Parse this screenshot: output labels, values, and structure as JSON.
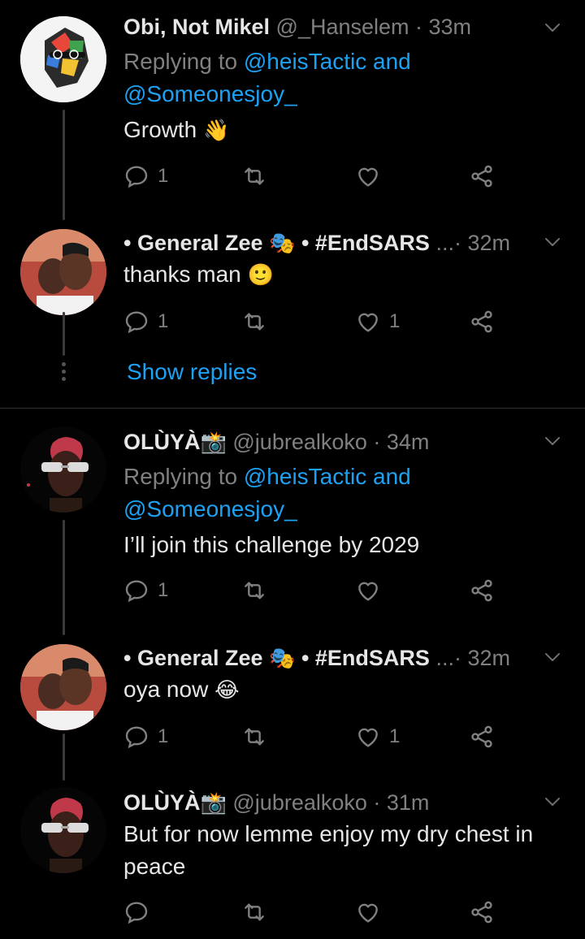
{
  "tweets": [
    {
      "name": "Obi, Not Mikel",
      "handle": "@_Hanselem",
      "time": "· 33m",
      "replying_prefix": "Replying to ",
      "replying_user1": "@heisTactic",
      "replying_and": " and",
      "replying_user2": "@Someonesjoy_",
      "text": "Growth",
      "emoji": "👋",
      "reply_count": "1",
      "like_count": ""
    },
    {
      "name_prefix": "• General Zee",
      "name_emoji": "🎭",
      "name_suffix": " • #EndSARS",
      "ellipsis": "...",
      "time": "· 32m",
      "text": "thanks man",
      "emoji": "🙂",
      "reply_count": "1",
      "like_count": "1"
    },
    {
      "name": "OLÙYÀ",
      "name_emoji": "📸",
      "handle": "@jubrealkoko",
      "time": "· 34m",
      "replying_prefix": "Replying to ",
      "replying_user1": "@heisTactic",
      "replying_and": " and",
      "replying_user2": "@Someonesjoy_",
      "text": "I’ll join this challenge by 2029",
      "reply_count": "1",
      "like_count": ""
    },
    {
      "name_prefix": "• General Zee",
      "name_emoji": "🎭",
      "name_suffix": " • #EndSARS",
      "ellipsis": "...",
      "time": "· 32m",
      "text": "oya now",
      "emoji": "😂",
      "reply_count": "1",
      "like_count": "1"
    },
    {
      "name": "OLÙYÀ",
      "name_emoji": "📸",
      "handle": "@jubrealkoko",
      "time": "· 31m",
      "text": "But for now lemme enjoy my dry chest in peace",
      "reply_count": "",
      "like_count": ""
    }
  ],
  "show_replies": "Show replies",
  "colors": {
    "link": "#1da1f2",
    "muted": "#808080",
    "text": "#e6e6e6",
    "background": "#000000"
  },
  "icons": [
    "reply-icon",
    "retweet-icon",
    "like-icon",
    "share-icon",
    "chevron-down-icon"
  ]
}
